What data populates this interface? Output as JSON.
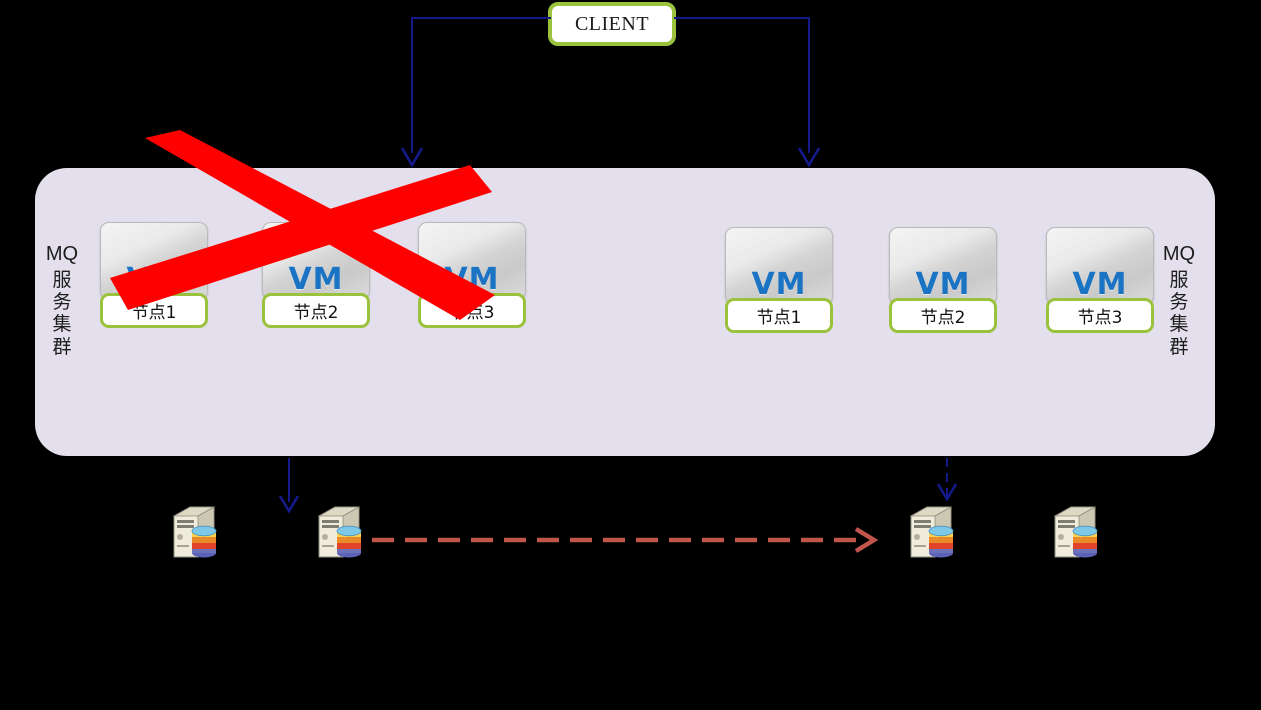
{
  "diagram": {
    "title_box": {
      "label": "CLIENT"
    },
    "panel": {
      "left_side_label": {
        "en": "MQ",
        "cn_chars": [
          "服",
          "务",
          "集",
          "群"
        ]
      },
      "right_side_label": {
        "en": "MQ",
        "cn_chars": [
          "服",
          "务",
          "集",
          "群"
        ]
      }
    },
    "cluster_failed": {
      "name": "failed-mq-cluster",
      "nodes": [
        {
          "badge": "VM",
          "caption": "节点1"
        },
        {
          "badge": "VM",
          "caption": "节点2"
        },
        {
          "badge": "VM",
          "caption": "节点3"
        }
      ]
    },
    "cluster_active": {
      "name": "active-mq-cluster",
      "nodes": [
        {
          "badge": "VM",
          "caption": "节点1"
        },
        {
          "badge": "VM",
          "caption": "节点2"
        },
        {
          "badge": "VM",
          "caption": "节点3"
        }
      ]
    },
    "database_servers": [
      {
        "name": "db-server-1"
      },
      {
        "name": "db-server-2"
      },
      {
        "name": "db-server-3"
      },
      {
        "name": "db-server-4"
      }
    ],
    "annotations": {
      "cross_out": {
        "name": "red-cross-out",
        "meaning": "failed cluster"
      },
      "replication": {
        "name": "dashed-replication-arrow",
        "direction": "left-to-right"
      }
    },
    "colors": {
      "panel_bg": "#e4dfec",
      "connector": "#141a8c",
      "node_border": "#9ac23c",
      "vm_text": "#1b73c4",
      "cross_out": "#fe0000",
      "replication_arrow": "#c0554a",
      "background": "#000000"
    }
  }
}
